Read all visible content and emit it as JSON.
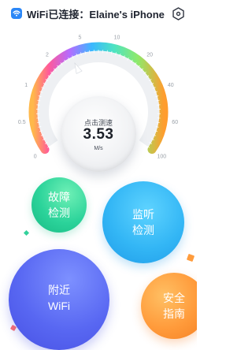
{
  "header": {
    "title": "WiFi已连接：Elaine's iPhone",
    "wifi_icon": "wifi-icon",
    "settings_icon": "hexagon-settings-icon"
  },
  "gauge": {
    "ticks": [
      "0",
      "0.5",
      "1",
      "2",
      "5",
      "10",
      "20",
      "40",
      "60",
      "100"
    ],
    "pointer_value": 5,
    "scale_type": "log",
    "colors": [
      "#ffb84a",
      "#ff5a9a",
      "#b46cff",
      "#3ab8ff",
      "#4de3c2",
      "#8ee96b",
      "#ff9d2e"
    ]
  },
  "speed": {
    "label": "点击测速",
    "value": "3.53",
    "unit": "M/s"
  },
  "actions": {
    "fault": "故障\n检测",
    "listen": "监听\n检测",
    "nearby": "附近\nWiFi",
    "safety": "安全\n指南"
  },
  "colors": {
    "fault": "#2bd39a",
    "listen": "#33b6f5",
    "nearby": "#5867f2",
    "safety": "#ff9a3a",
    "accent": "#2b87f7"
  }
}
